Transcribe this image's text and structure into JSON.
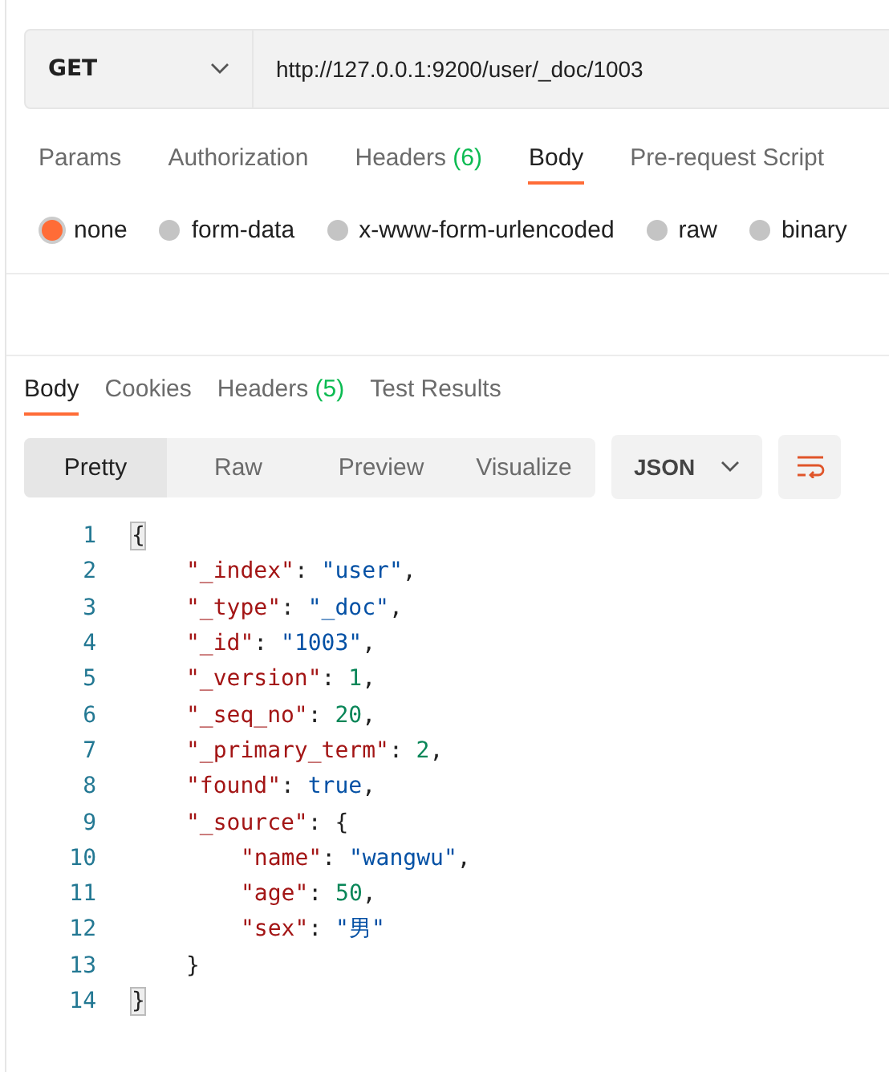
{
  "request": {
    "method": "GET",
    "url": "http://127.0.0.1:9200/user/_doc/1003"
  },
  "request_tabs": [
    {
      "label": "Params",
      "selected": false
    },
    {
      "label": "Authorization",
      "selected": false
    },
    {
      "label": "Headers",
      "count": "(6)",
      "selected": false
    },
    {
      "label": "Body",
      "selected": true
    },
    {
      "label": "Pre-request Script",
      "selected": false
    }
  ],
  "body_types": [
    {
      "label": "none",
      "selected": true
    },
    {
      "label": "form-data",
      "selected": false
    },
    {
      "label": "x-www-form-urlencoded",
      "selected": false
    },
    {
      "label": "raw",
      "selected": false
    },
    {
      "label": "binary",
      "selected": false
    }
  ],
  "response_tabs": [
    {
      "label": "Body",
      "selected": true
    },
    {
      "label": "Cookies",
      "selected": false
    },
    {
      "label": "Headers",
      "count": "(5)",
      "selected": false
    },
    {
      "label": "Test Results",
      "selected": false
    }
  ],
  "view_modes": [
    {
      "label": "Pretty",
      "selected": true
    },
    {
      "label": "Raw",
      "selected": false
    },
    {
      "label": "Preview",
      "selected": false
    },
    {
      "label": "Visualize",
      "selected": false
    }
  ],
  "format": "JSON",
  "code_lines": [
    {
      "number": "1",
      "tokens": [
        {
          "kind": "brace",
          "text": "{"
        }
      ],
      "children": [
        {
          "number": "2",
          "tokens": [
            {
              "kind": "key",
              "text": "\"_index\""
            },
            {
              "kind": "punct",
              "text": ": "
            },
            {
              "kind": "string",
              "text": "\"user\""
            },
            {
              "kind": "punct",
              "text": ","
            }
          ]
        },
        {
          "number": "3",
          "tokens": [
            {
              "kind": "key",
              "text": "\"_type\""
            },
            {
              "kind": "punct",
              "text": ": "
            },
            {
              "kind": "string",
              "text": "\"_doc\""
            },
            {
              "kind": "punct",
              "text": ","
            }
          ]
        },
        {
          "number": "4",
          "tokens": [
            {
              "kind": "key",
              "text": "\"_id\""
            },
            {
              "kind": "punct",
              "text": ": "
            },
            {
              "kind": "string",
              "text": "\"1003\""
            },
            {
              "kind": "punct",
              "text": ","
            }
          ]
        },
        {
          "number": "5",
          "tokens": [
            {
              "kind": "key",
              "text": "\"_version\""
            },
            {
              "kind": "punct",
              "text": ": "
            },
            {
              "kind": "number",
              "text": "1"
            },
            {
              "kind": "punct",
              "text": ","
            }
          ]
        },
        {
          "number": "6",
          "tokens": [
            {
              "kind": "key",
              "text": "\"_seq_no\""
            },
            {
              "kind": "punct",
              "text": ": "
            },
            {
              "kind": "number",
              "text": "20"
            },
            {
              "kind": "punct",
              "text": ","
            }
          ]
        },
        {
          "number": "7",
          "tokens": [
            {
              "kind": "key",
              "text": "\"_primary_term\""
            },
            {
              "kind": "punct",
              "text": ": "
            },
            {
              "kind": "number",
              "text": "2"
            },
            {
              "kind": "punct",
              "text": ","
            }
          ]
        },
        {
          "number": "8",
          "tokens": [
            {
              "kind": "key",
              "text": "\"found\""
            },
            {
              "kind": "punct",
              "text": ": "
            },
            {
              "kind": "bool",
              "text": "true"
            },
            {
              "kind": "punct",
              "text": ","
            }
          ]
        },
        {
          "number": "9",
          "tokens": [
            {
              "kind": "key",
              "text": "\"_source\""
            },
            {
              "kind": "punct",
              "text": ": "
            },
            {
              "kind": "punct",
              "text": "{"
            }
          ],
          "children": [
            {
              "number": "10",
              "tokens": [
                {
                  "kind": "key",
                  "text": "\"name\""
                },
                {
                  "kind": "punct",
                  "text": ": "
                },
                {
                  "kind": "string",
                  "text": "\"wangwu\""
                },
                {
                  "kind": "punct",
                  "text": ","
                }
              ]
            },
            {
              "number": "11",
              "tokens": [
                {
                  "kind": "key",
                  "text": "\"age\""
                },
                {
                  "kind": "punct",
                  "text": ": "
                },
                {
                  "kind": "number",
                  "text": "50"
                },
                {
                  "kind": "punct",
                  "text": ","
                }
              ]
            },
            {
              "number": "12",
              "tokens": [
                {
                  "kind": "key",
                  "text": "\"sex\""
                },
                {
                  "kind": "punct",
                  "text": ": "
                },
                {
                  "kind": "string",
                  "text": "\"男\""
                }
              ]
            }
          ]
        },
        {
          "number": "13",
          "tokens": [
            {
              "kind": "punct",
              "text": "}"
            }
          ]
        }
      ]
    },
    {
      "number": "14",
      "tokens": [
        {
          "kind": "brace",
          "text": "}"
        }
      ]
    }
  ]
}
